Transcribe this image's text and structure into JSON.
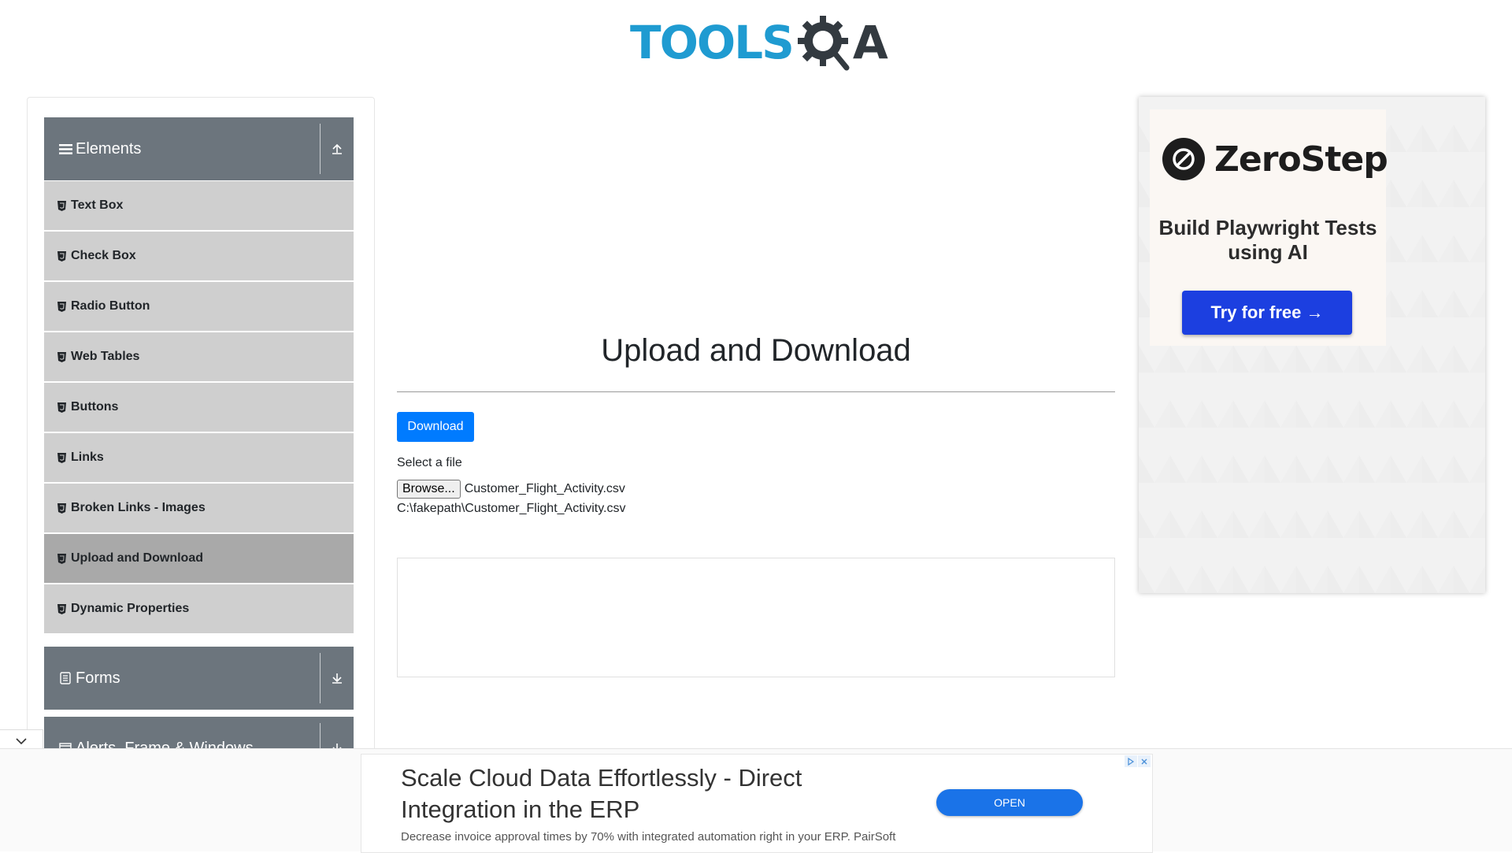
{
  "header": {
    "logo_text_primary": "TOOLS",
    "logo_text_secondary": "A",
    "logo_colors": {
      "primary": "#1f9bd1",
      "secondary": "#333a40"
    }
  },
  "sidebar": {
    "groups": [
      {
        "label": "Elements",
        "icon": "hamburger-icon",
        "toggle_icon": "arrow-up-icon"
      },
      {
        "label": "Forms",
        "icon": "document-icon",
        "toggle_icon": "arrow-down-icon"
      },
      {
        "label": "Alerts, Frame & Windows",
        "icon": "window-icon",
        "toggle_icon": "arrow-down-icon"
      }
    ],
    "items": [
      {
        "label": "Text Box"
      },
      {
        "label": "Check Box"
      },
      {
        "label": "Radio Button"
      },
      {
        "label": "Web Tables"
      },
      {
        "label": "Buttons"
      },
      {
        "label": "Links"
      },
      {
        "label": "Broken Links - Images"
      },
      {
        "label": "Upload and Download",
        "active": true
      },
      {
        "label": "Dynamic Properties"
      }
    ],
    "colors": {
      "header": "#6c757d",
      "item": "#cfcfcf",
      "active_item": "#a9a9a9"
    }
  },
  "main": {
    "title": "Upload and Download",
    "download_label": "Download",
    "select_label": "Select a file",
    "browse_label": "Browse...",
    "selected_file": "Customer_Flight_Activity.csv",
    "uploaded_path": "C:\\fakepath\\Customer_Flight_Activity.csv",
    "accent": "#007bff"
  },
  "right_ad": {
    "brand": "ZeroStep",
    "tagline": "Build Playwright Tests using AI",
    "cta": "Try for free →",
    "cta_color": "#1c3fe0"
  },
  "bottom_ad": {
    "headline": "Scale Cloud Data Effortlessly - Direct Integration in the ERP",
    "description": "Decrease invoice approval times by 70% with integrated automation right in your ERP. PairSoft",
    "cta": "OPEN",
    "cta_color": "#1a73e8"
  }
}
